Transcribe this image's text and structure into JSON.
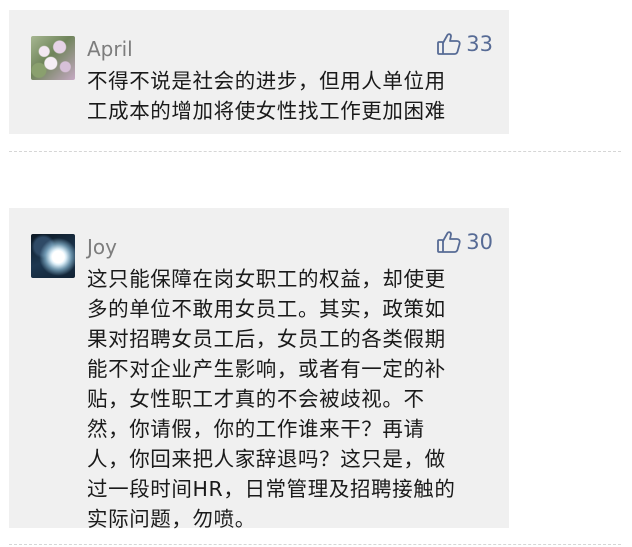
{
  "comments": [
    {
      "user": "April",
      "likes": "33",
      "text": "不得不说是社会的进步，但用人单位用\n工成本的增加将使女性找工作更加困难"
    },
    {
      "user": "Joy",
      "likes": "30",
      "text": "这只能保障在岗女职工的权益，却使更\n多的单位不敢用女员工。其实，政策如\n果对招聘女员工后，女员工的各类假期\n能不对企业产生影响，或者有一定的补\n贴，女性职工才真的不会被歧视。不\n然，你请假，你的工作谁来干？再请\n人，你回来把人家辞退吗？这只是，做\n过一段时间HR，日常管理及招聘接触的\n实际问题，勿喷。"
    }
  ],
  "icons": {
    "like": "thumbs-up-icon"
  },
  "colors": {
    "card_background": "#f0f0f0",
    "like_accent": "#576b95",
    "username": "#7d7d7d",
    "text": "#1a1a1a"
  }
}
